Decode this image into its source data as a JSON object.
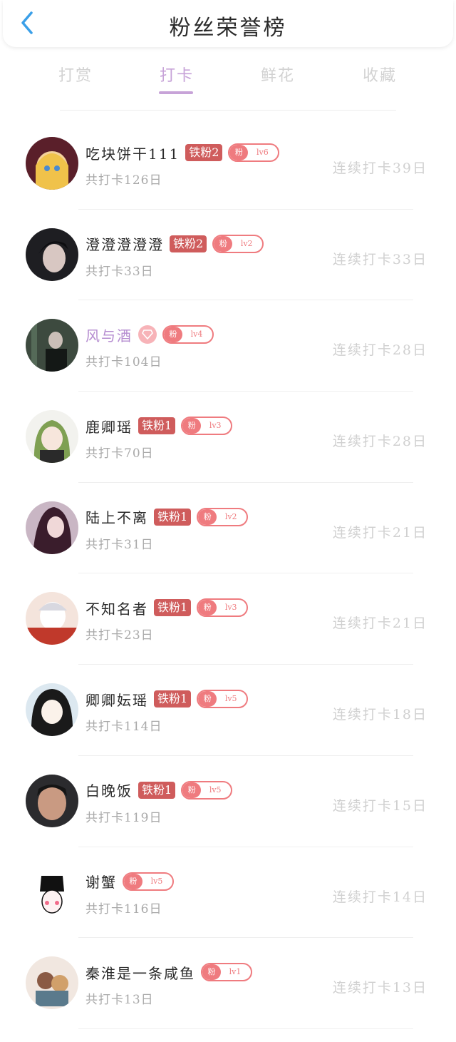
{
  "header": {
    "title": "粉丝荣誉榜",
    "back_icon": "chevron-left-icon",
    "accent_color": "#3a9fe8"
  },
  "tabs": [
    {
      "label": "打赏",
      "active": false
    },
    {
      "label": "打卡",
      "active": true
    },
    {
      "label": "鲜花",
      "active": false
    },
    {
      "label": "收藏",
      "active": false
    }
  ],
  "colors": {
    "active_tab": "#c7a3d8",
    "iron_badge": "#cf5c5c",
    "fan_pill": "#ef7b7f",
    "vip_name": "#b58cd0"
  },
  "fan_pill_label": "粉",
  "fans": [
    {
      "name": "吃块饼干111",
      "badge": "铁粉2",
      "level": "lv6",
      "total": "共打卡126日",
      "streak": "连续打卡39日"
    },
    {
      "name": "澄澄澄澄澄",
      "badge": "铁粉2",
      "level": "lv2",
      "total": "共打卡33日",
      "streak": "连续打卡33日"
    },
    {
      "name": "风与酒",
      "badge": "",
      "gem": true,
      "vip": true,
      "level": "lv4",
      "total": "共打卡104日",
      "streak": "连续打卡28日"
    },
    {
      "name": "鹿卿瑶",
      "badge": "铁粉1",
      "level": "lv3",
      "total": "共打卡70日",
      "streak": "连续打卡28日"
    },
    {
      "name": "陆上不离",
      "badge": "铁粉1",
      "level": "lv2",
      "total": "共打卡31日",
      "streak": "连续打卡21日"
    },
    {
      "name": "不知名者",
      "badge": "铁粉1",
      "level": "lv3",
      "total": "共打卡23日",
      "streak": "连续打卡21日"
    },
    {
      "name": "卿卿妘瑶",
      "badge": "铁粉1",
      "level": "lv5",
      "total": "共打卡114日",
      "streak": "连续打卡18日"
    },
    {
      "name": "白晚饭",
      "badge": "铁粉1",
      "level": "lv5",
      "total": "共打卡119日",
      "streak": "连续打卡15日"
    },
    {
      "name": "谢蟹",
      "badge": "",
      "level": "lv5",
      "total": "共打卡116日",
      "streak": "连续打卡14日"
    },
    {
      "name": "秦淮是一条咸鱼",
      "badge": "",
      "level": "lv1",
      "total": "共打卡13日",
      "streak": "连续打卡13日"
    }
  ]
}
